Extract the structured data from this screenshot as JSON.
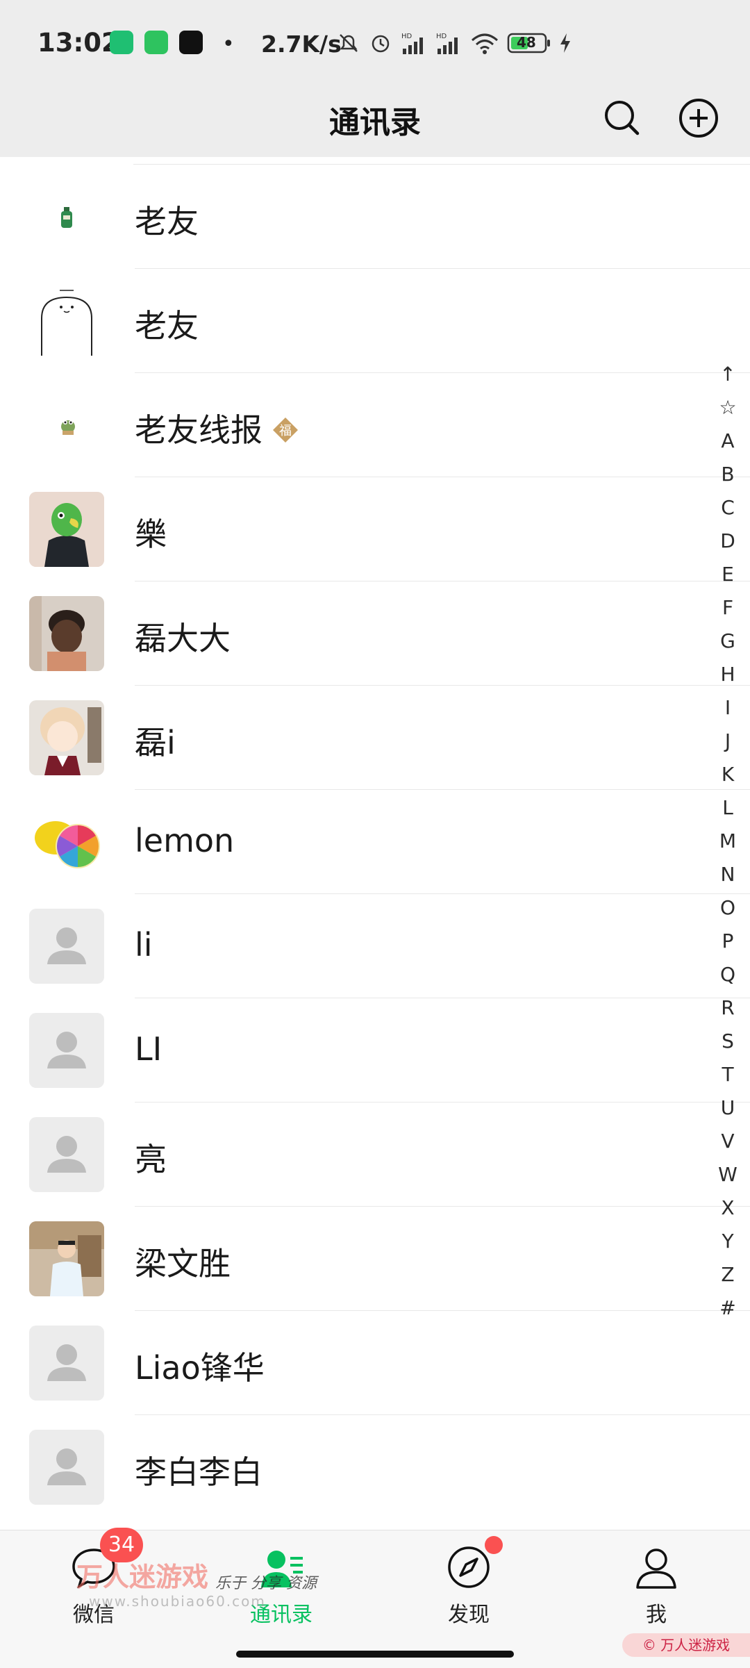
{
  "status_bar": {
    "time": "13:02",
    "net_speed": "2.7K/s",
    "battery": "48",
    "icons": [
      "security-app-icon",
      "wechat-app-icon",
      "tiktok-app-icon",
      "mute-icon",
      "alarm-icon",
      "hd-signal-icon",
      "hd-signal-icon",
      "wifi-icon",
      "battery-icon",
      "charging-icon"
    ]
  },
  "header": {
    "title": "通讯录",
    "search_icon": "search-icon",
    "add_icon": "add-circle-icon"
  },
  "contacts": [
    {
      "name": "老友",
      "avatar": "small-bottle-sticker"
    },
    {
      "name": "老友",
      "avatar": "ghost-doodle-sticker"
    },
    {
      "name": "老友线报",
      "avatar": "small-frog-sticker",
      "badge": "福"
    },
    {
      "name": "樂",
      "avatar": "green-parrot-photo"
    },
    {
      "name": "磊大大",
      "avatar": "child-photo"
    },
    {
      "name": "磊i",
      "avatar": "anime-boy-photo"
    },
    {
      "name": "lemon",
      "avatar": "lemon-photo"
    },
    {
      "name": "li",
      "avatar": "default-avatar"
    },
    {
      "name": "LI",
      "avatar": "default-avatar"
    },
    {
      "name": "亮",
      "avatar": "default-avatar"
    },
    {
      "name": "梁文胜",
      "avatar": "person-photo"
    },
    {
      "name": "Liao锋华",
      "avatar": "default-avatar"
    },
    {
      "name": "李白李白",
      "avatar": "default-avatar"
    }
  ],
  "alphabet_index": [
    "↑",
    "☆",
    "A",
    "B",
    "C",
    "D",
    "E",
    "F",
    "G",
    "H",
    "I",
    "J",
    "K",
    "L",
    "M",
    "N",
    "O",
    "P",
    "Q",
    "R",
    "S",
    "T",
    "U",
    "V",
    "W",
    "X",
    "Y",
    "Z",
    "#"
  ],
  "tabs": [
    {
      "label": "微信",
      "icon": "chat-bubble-icon",
      "badge": "34"
    },
    {
      "label": "通讯录",
      "icon": "contacts-icon",
      "active": true
    },
    {
      "label": "发现",
      "icon": "compass-icon",
      "dot": true
    },
    {
      "label": "我",
      "icon": "person-icon"
    }
  ],
  "watermark": {
    "title": "万人迷游戏",
    "slogan": "乐于 分享 资源",
    "url": "www.shoubiao60.com",
    "corner": "© 万人迷游戏"
  },
  "colors": {
    "accent_green": "#07c160",
    "badge_red": "#fa5151",
    "header_bg": "#ededed",
    "fu_badge": "#c9a063"
  }
}
